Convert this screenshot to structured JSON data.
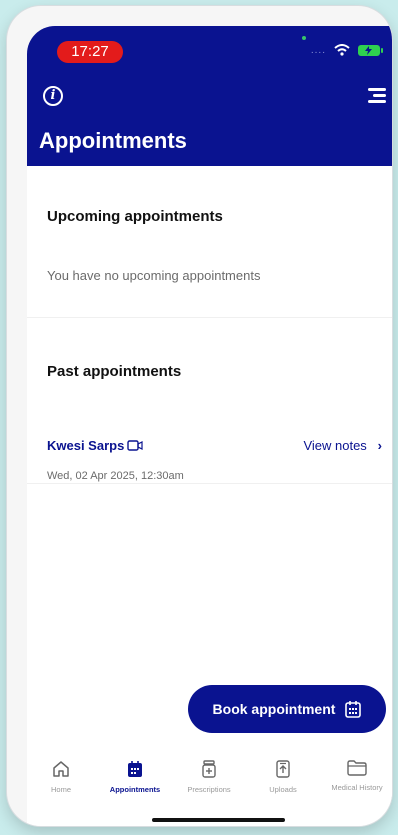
{
  "status_bar": {
    "time": "17:27",
    "signal_dots": "....",
    "accent_time_pill": "#e31b1b"
  },
  "header": {
    "title": "Appointments",
    "info_icon": "info-icon",
    "menu_icon": "menu-icon"
  },
  "upcoming": {
    "title": "Upcoming appointments",
    "empty_message": "You have no upcoming appointments"
  },
  "past": {
    "title": "Past appointments",
    "items": [
      {
        "doctor": "Kwesi Sarps",
        "mode_icon": "video-camera-icon",
        "action_label": "View notes",
        "action_chevron": "›",
        "date": "Wed, 02 Apr 2025, 12:30am"
      }
    ]
  },
  "book_button": {
    "label": "Book appointment",
    "icon": "calendar-icon"
  },
  "tabs": [
    {
      "label": "Home",
      "icon": "home-icon",
      "active": false
    },
    {
      "label": "Appointments",
      "icon": "calendar-icon",
      "active": true
    },
    {
      "label": "Prescriptions",
      "icon": "prescription-icon",
      "active": false
    },
    {
      "label": "Uploads",
      "icon": "upload-icon",
      "active": false
    },
    {
      "label": "Medical History",
      "icon": "folder-icon",
      "active": false
    }
  ],
  "colors": {
    "primary": "#0a1390",
    "muted_text": "#6b6b6b",
    "background": "#c9ecec"
  }
}
